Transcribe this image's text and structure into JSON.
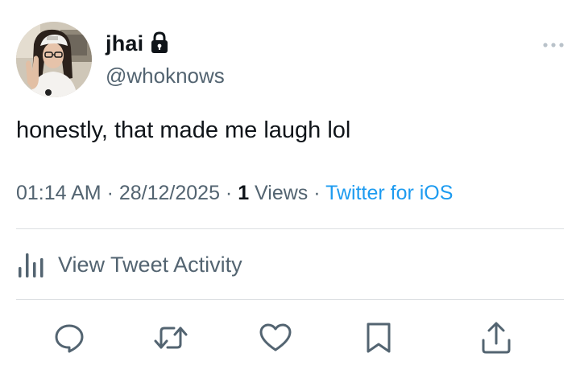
{
  "user": {
    "display_name": "jhai",
    "handle": "@whoknows",
    "protected": true
  },
  "tweet": {
    "text": "honestly, that made me laugh lol"
  },
  "meta": {
    "time": "01:14 AM",
    "separator1": " · ",
    "date": "28/12/2025",
    "separator2": " · ",
    "views_count": "1",
    "views_label": " Views",
    "separator3": " · ",
    "source": "Twitter for iOS"
  },
  "activity": {
    "label": "View Tweet Activity"
  },
  "colors": {
    "text_primary": "#0f1419",
    "text_secondary": "#536471",
    "link": "#1d9bf0",
    "divider": "#dcdfe2"
  },
  "icons": {
    "lock": "lock-icon",
    "more": "more-horizontal-icon",
    "activity": "bar-chart-icon",
    "reply": "reply-icon",
    "retweet": "retweet-icon",
    "like": "heart-icon",
    "bookmark": "bookmark-icon",
    "share": "share-icon"
  }
}
